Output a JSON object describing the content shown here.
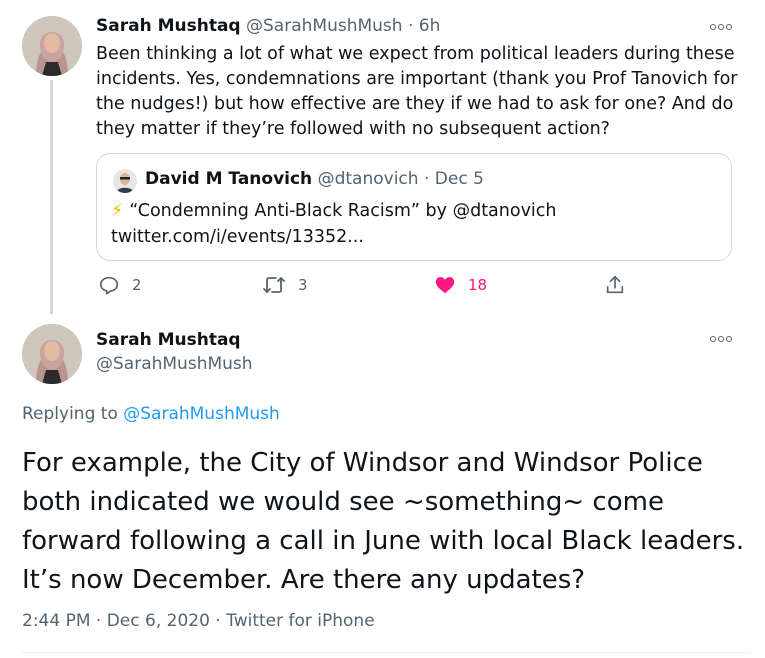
{
  "tweet1": {
    "author_name": "Sarah Mushtaq",
    "handle": "@SarahMushMush",
    "separator": "·",
    "time": "6h",
    "text": "Been thinking a lot of what we expect from political leaders during these incidents. Yes, condemnations are important (thank you Prof Tanovich for the nudges!) but how effective are they if we had to ask for one? And do they matter if they’re followed with no subsequent action?",
    "quote": {
      "author_name": "David M Tanovich",
      "handle": "@dtanovich",
      "separator": "·",
      "date": "Dec 5",
      "icon": "lightning-bolt-icon",
      "text": "“Condemning Anti-Black Racism” by @dtanovich twitter.com/i/events/13352..."
    },
    "actions": {
      "reply_count": "2",
      "retweet_count": "3",
      "like_count": "18"
    }
  },
  "tweet2": {
    "author_name": "Sarah Mushtaq",
    "handle": "@SarahMushMush",
    "replying_prefix": "Replying to ",
    "replying_to": "@SarahMushMush",
    "text": "For example, the City of Windsor and Windsor Police both indicated we would see ~something~ come forward following a call in June with local Black leaders. It’s now December. Are there any updates?",
    "time": "2:44 PM",
    "separator1": "·",
    "date": "Dec 6, 2020",
    "separator2": "·",
    "source": "Twitter for iPhone"
  },
  "colors": {
    "text": "#0f1419",
    "muted": "#536471",
    "link": "#1d9bf0",
    "like": "#f91880",
    "border": "#cfd9de"
  }
}
